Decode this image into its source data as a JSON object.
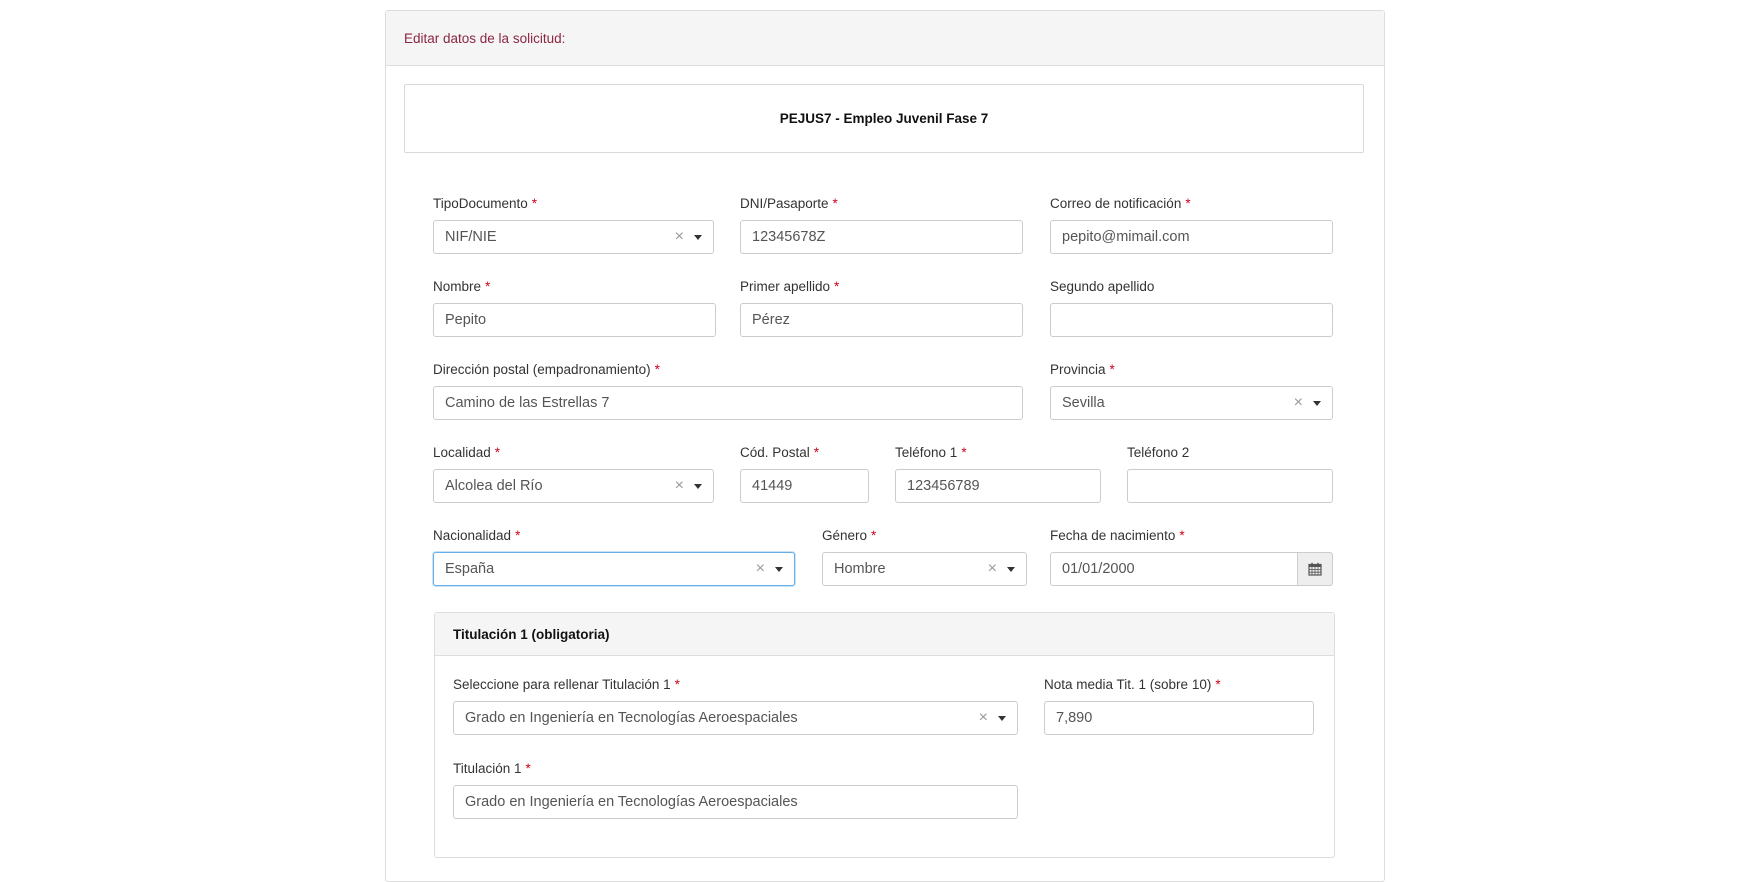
{
  "panel": {
    "heading": "Editar datos de la solicitud:"
  },
  "program": {
    "title": "PEJUS7 - Empleo Juvenil Fase 7"
  },
  "required_mark": "*",
  "fields": {
    "tipo_documento": {
      "label": "TipoDocumento",
      "value": "NIF/NIE"
    },
    "dni": {
      "label": "DNI/Pasaporte",
      "value": "12345678Z"
    },
    "correo": {
      "label": "Correo de notificación",
      "value": "pepito@mimail.com"
    },
    "nombre": {
      "label": "Nombre",
      "value": "Pepito"
    },
    "primer_apellido": {
      "label": "Primer apellido",
      "value": "Pérez"
    },
    "segundo_apellido": {
      "label": "Segundo apellido",
      "value": ""
    },
    "direccion": {
      "label": "Dirección postal (empadronamiento)",
      "value": "Camino de las Estrellas 7"
    },
    "provincia": {
      "label": "Provincia",
      "value": "Sevilla"
    },
    "localidad": {
      "label": "Localidad",
      "value": "Alcolea del Río"
    },
    "cod_postal": {
      "label": "Cód. Postal",
      "value": "41449"
    },
    "telefono1": {
      "label": "Teléfono 1",
      "value": "123456789"
    },
    "telefono2": {
      "label": "Teléfono 2",
      "value": ""
    },
    "nacionalidad": {
      "label": "Nacionalidad",
      "value": "España"
    },
    "genero": {
      "label": "Género",
      "value": "Hombre"
    },
    "fecha_nacimiento": {
      "label": "Fecha de nacimiento",
      "value": "01/01/2000"
    }
  },
  "titulacion1": {
    "heading": "Titulación 1 (obligatoria)",
    "seleccione": {
      "label": "Seleccione para rellenar Titulación 1",
      "value": "Grado en Ingeniería en Tecnologías Aeroespaciales"
    },
    "nota": {
      "label": "Nota media Tit. 1 (sobre 10)",
      "value": "7,890"
    },
    "titulacion": {
      "label": "Titulación 1",
      "value": "Grado en Ingeniería en Tecnologías Aeroespaciales"
    }
  },
  "icons": {
    "clear": "close-icon",
    "dropdown": "caret-down-icon",
    "date": "calendar-icon"
  }
}
